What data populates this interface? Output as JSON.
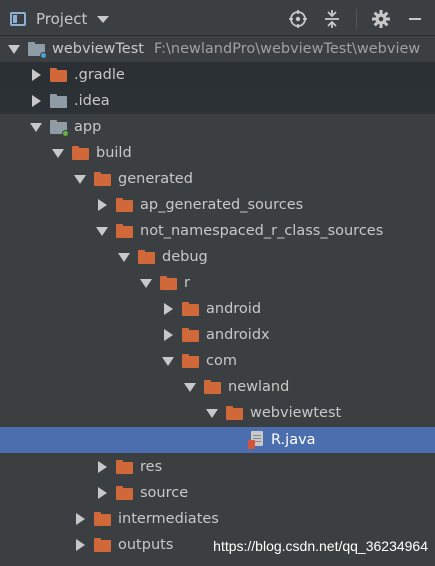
{
  "toolbar": {
    "title": "Project",
    "icons": [
      "locate-icon",
      "collapse-icon",
      "gear-icon",
      "hide-icon"
    ]
  },
  "tree": {
    "root": {
      "name": "webviewTest",
      "path": "F:\\newlandPro\\webviewTest\\webview"
    },
    "gradle": ".gradle",
    "idea": ".idea",
    "app": "app",
    "build": "build",
    "generated": "generated",
    "ap_generated_sources": "ap_generated_sources",
    "not_namespaced": "not_namespaced_r_class_sources",
    "debug": "debug",
    "r": "r",
    "android": "android",
    "androidx": "androidx",
    "com": "com",
    "newland": "newland",
    "webviewtest": "webviewtest",
    "rjava": "R.java",
    "res": "res",
    "source": "source",
    "intermediates": "intermediates",
    "outputs": "outputs"
  },
  "watermark": "https://blog.csdn.net/qq_36234964",
  "colors": {
    "folder": "#d0683a",
    "excluded_folder": "#8f9ca6",
    "selection": "#4b6eaf",
    "module_dot": "#62b543"
  }
}
